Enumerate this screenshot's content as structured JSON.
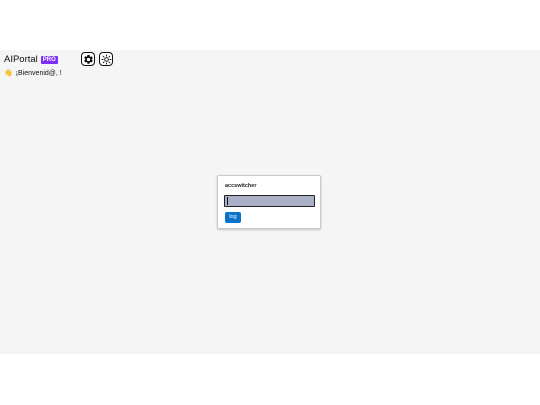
{
  "header": {
    "brand_name": "AIPortal",
    "badge": "PRO",
    "settings_icon": "gear-icon",
    "theme_icon": "sun-icon",
    "greeting": "¡Bienvenid@, !",
    "greeting_icon": "waving-hand-icon"
  },
  "login_card": {
    "title": "accswitcher",
    "input_value": "",
    "button_label": "log"
  },
  "colors": {
    "badge": "#7b2ff7",
    "button": "#0b72c9",
    "input_bg": "#aab0c8",
    "app_bg": "#f5f5f5"
  }
}
